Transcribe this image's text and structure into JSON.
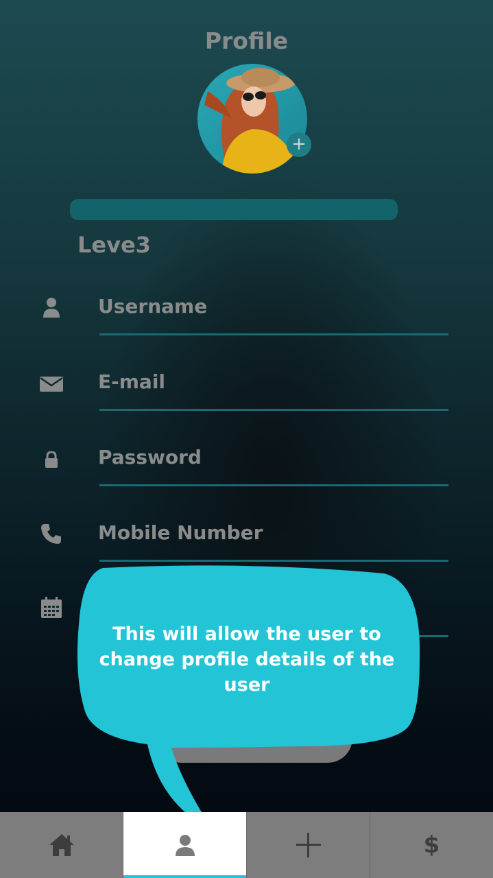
{
  "header": {
    "title": "Profile"
  },
  "avatar": {
    "add_icon": "plus-icon"
  },
  "level": {
    "label": "Leve3"
  },
  "fields": [
    {
      "label": "Username",
      "icon": "user-icon"
    },
    {
      "label": "E-mail",
      "icon": "mail-icon"
    },
    {
      "label": "Password",
      "icon": "lock-icon"
    },
    {
      "label": "Mobile Number",
      "icon": "phone-icon"
    },
    {
      "label": "",
      "icon": "calendar-icon"
    }
  ],
  "tooltip": {
    "line1": "This will allow the user to",
    "line2": "change profile details of the user"
  },
  "bottom_nav": [
    {
      "icon": "home-icon"
    },
    {
      "icon": "user-icon",
      "active": true
    },
    {
      "icon": "plus-icon"
    },
    {
      "icon": "dollar-icon",
      "glyph": "$"
    }
  ],
  "colors": {
    "accent": "#23c4d6",
    "bar": "#13636b",
    "text_gray": "#8a8c8c",
    "bubble": "#22c4d6"
  }
}
